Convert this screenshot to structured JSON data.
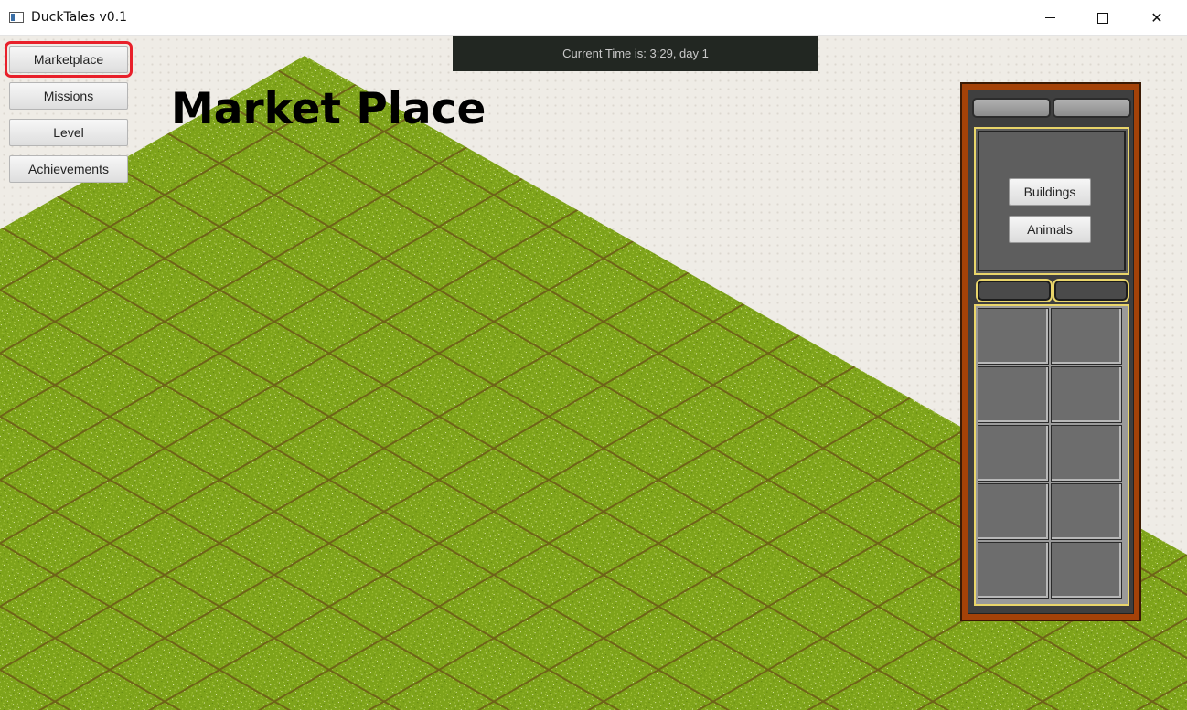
{
  "window": {
    "title": "DuckTales v0.1",
    "controls": {
      "minimize": "minimize-icon",
      "maximize": "maximize-icon",
      "close": "✕"
    }
  },
  "nav": {
    "items": [
      {
        "label": "Marketplace",
        "active": true
      },
      {
        "label": "Missions",
        "active": false
      },
      {
        "label": "Level",
        "active": false
      },
      {
        "label": "Achievements",
        "active": false
      }
    ]
  },
  "status": {
    "time_text": "Current Time is: 3:29, day 1"
  },
  "page": {
    "heading": "Market Place"
  },
  "market_panel": {
    "categories": [
      "Buildings",
      "Animals"
    ],
    "slot_count": 10
  },
  "colors": {
    "active_outline": "#e8202a",
    "grass": "#7ea31a",
    "panel_frame": "#a44208",
    "panel_accent": "#e9d56a",
    "time_bar": "#222722"
  }
}
